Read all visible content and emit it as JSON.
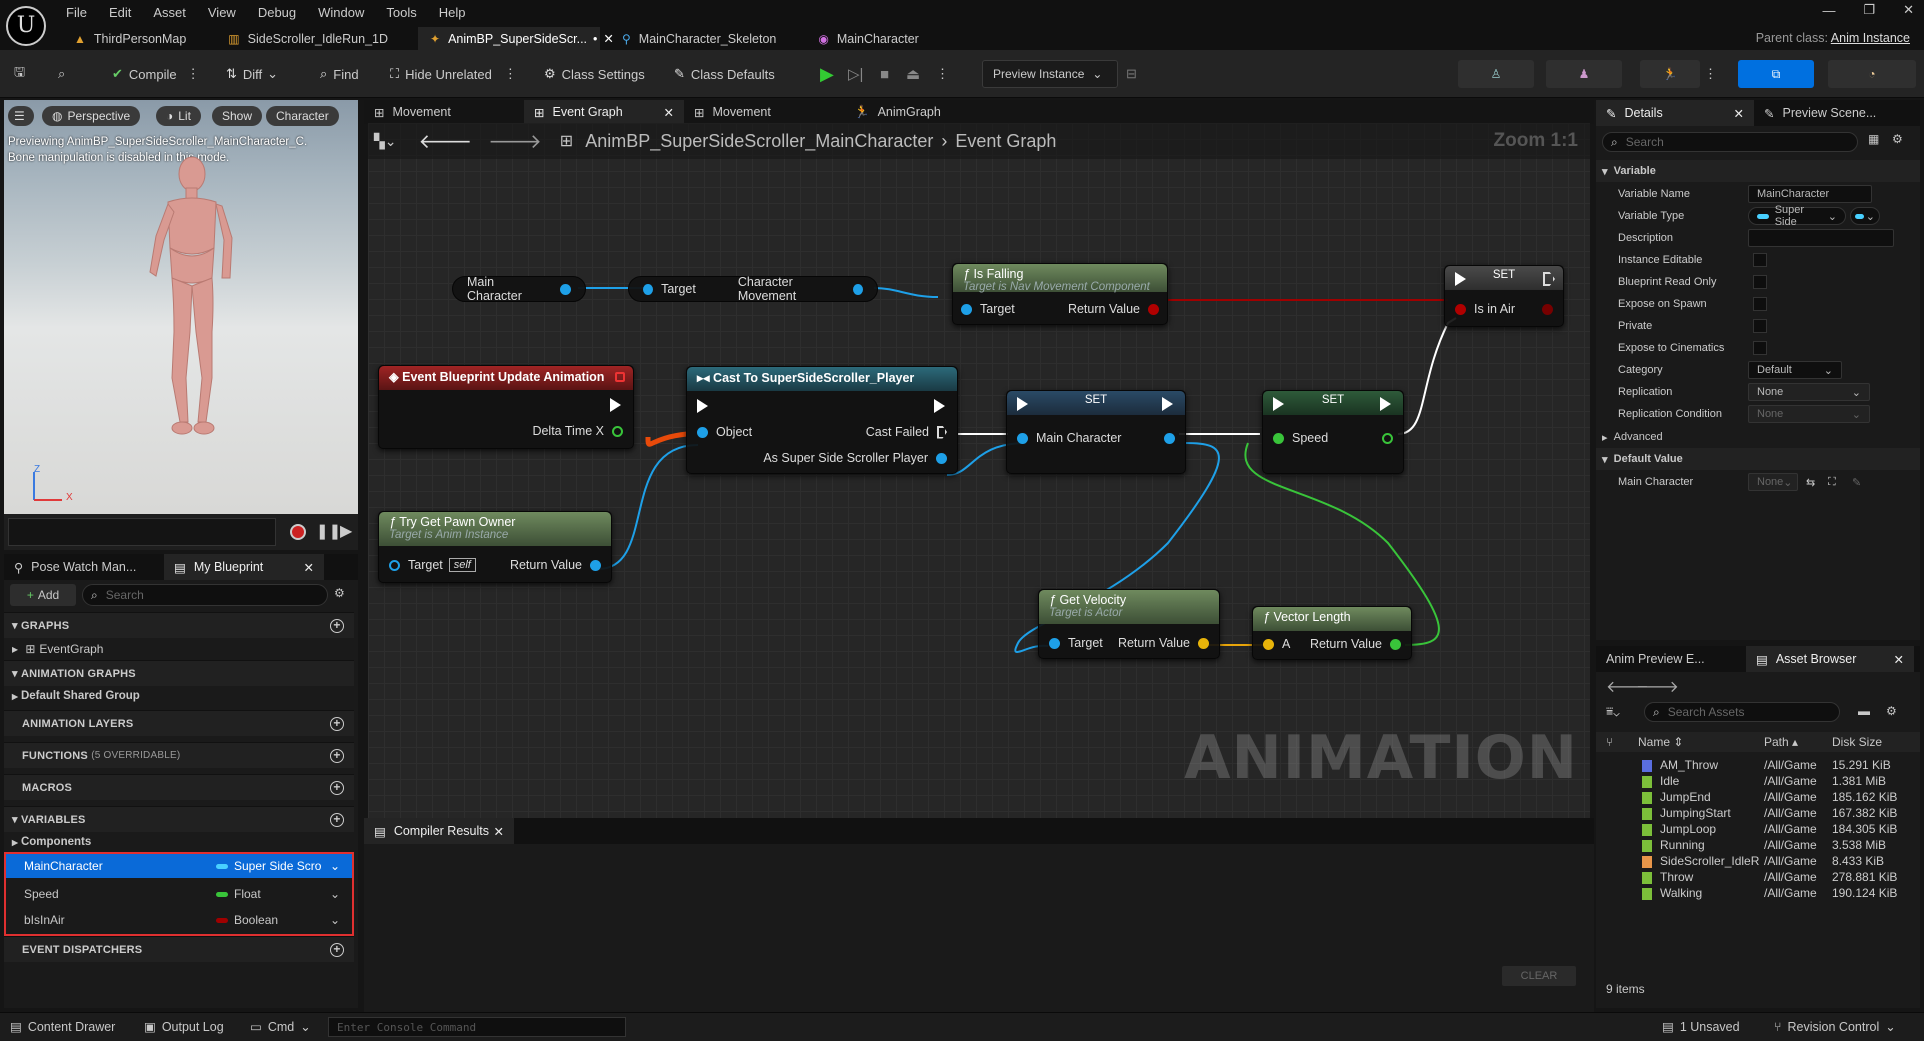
{
  "titlebar": {
    "menu": [
      "File",
      "Edit",
      "Asset",
      "View",
      "Debug",
      "Window",
      "Tools",
      "Help"
    ],
    "tabs": [
      {
        "label": "ThirdPersonMap",
        "icon": "level-icon"
      },
      {
        "label": "SideScroller_IdleRun_1D",
        "icon": "blendspace-icon"
      },
      {
        "label": "AnimBP_SuperSideScr...",
        "icon": "animbp-icon",
        "active": true,
        "badge": "•"
      },
      {
        "label": "MainCharacter_Skeleton",
        "icon": "skeleton-icon"
      },
      {
        "label": "MainCharacter",
        "icon": "mesh-icon"
      }
    ],
    "parent_label": "Parent class:",
    "parent_value": "Anim Instance"
  },
  "toolbar": {
    "compile": "Compile",
    "diff": "Diff",
    "find": "Find",
    "hide_unrelated": "Hide Unrelated",
    "class_settings": "Class Settings",
    "class_defaults": "Class Defaults",
    "preview_instance": "Preview Instance"
  },
  "viewport": {
    "perspective": "Perspective",
    "lit": "Lit",
    "show": "Show",
    "character": "Character",
    "msg1": "Previewing AnimBP_SuperSideScroller_MainCharacter_C.",
    "msg2": "Bone manipulation is disabled in this mode.",
    "axis_z": "Z",
    "axis_x": "X"
  },
  "left_panel": {
    "tab_pose": "Pose Watch Man...",
    "tab_bp": "My Blueprint",
    "add": "Add",
    "search_placeholder": "Search",
    "graphs": "GRAPHS",
    "event_graph": "EventGraph",
    "anim_graphs": "ANIMATION GRAPHS",
    "default_group": "Default Shared Group",
    "anim_layers": "ANIMATION LAYERS",
    "functions": "FUNCTIONS",
    "functions_note": "(5 OVERRIDABLE)",
    "macros": "MACROS",
    "variables": "VARIABLES",
    "components": "Components",
    "vars": [
      {
        "name": "MainCharacter",
        "type": "Super Side Scroll",
        "color": "#1ea0e8",
        "selected": true
      },
      {
        "name": "Speed",
        "type": "Float",
        "color": "#39c43a",
        "selected": false
      },
      {
        "name": "bIsInAir",
        "type": "Boolean",
        "color": "#a00000",
        "selected": false
      }
    ],
    "dispatchers": "EVENT DISPATCHERS"
  },
  "graph_tabs": {
    "t1": "Movement",
    "t2": "Event Graph",
    "t3": "Movement",
    "t4": "AnimGraph"
  },
  "graph": {
    "breadcrumb_bp": "AnimBP_SuperSideScroller_MainCharacter",
    "breadcrumb_graph": "Event Graph",
    "zoom": "Zoom 1:1",
    "watermark": "ANIMATION",
    "main_character_var": "Main Character",
    "char_move_target": "Target",
    "char_move_out": "Character Movement",
    "is_falling_title": "Is Falling",
    "is_falling_sub": "Target is Nav Movement Component",
    "is_falling_target": "Target",
    "is_falling_return": "Return Value",
    "set1_title": "SET",
    "set1_pin": "Is in Air",
    "event_title": "Event Blueprint Update Animation",
    "event_delta": "Delta Time X",
    "cast_title": "Cast To SuperSideScroller_Player",
    "cast_object": "Object",
    "cast_failed": "Cast Failed",
    "cast_as": "As Super Side Scroller Player",
    "set2_title": "SET",
    "set2_pin": "Main Character",
    "set3_title": "SET",
    "set3_pin": "Speed",
    "pawn_title": "Try Get Pawn Owner",
    "pawn_sub": "Target is Anim Instance",
    "pawn_target": "Target",
    "pawn_self": "self",
    "pawn_return": "Return Value",
    "vel_title": "Get Velocity",
    "vel_sub": "Target is Actor",
    "vel_target": "Target",
    "vel_return": "Return Value",
    "len_title": "Vector Length",
    "len_a": "A",
    "len_return": "Return Value"
  },
  "compiler": {
    "tab": "Compiler Results",
    "clear": "CLEAR"
  },
  "details": {
    "tab": "Details",
    "tab2": "Preview Scene...",
    "search_placeholder": "Search",
    "section_variable": "Variable",
    "rows": [
      {
        "label": "Variable Name",
        "value": "MainCharacter",
        "kind": "field"
      },
      {
        "label": "Variable Type",
        "value": "Super Side",
        "kind": "type"
      },
      {
        "label": "Description",
        "value": "",
        "kind": "field"
      },
      {
        "label": "Instance Editable",
        "kind": "check"
      },
      {
        "label": "Blueprint Read Only",
        "kind": "check"
      },
      {
        "label": "Expose on Spawn",
        "kind": "check"
      },
      {
        "label": "Private",
        "kind": "check"
      },
      {
        "label": "Expose to Cinematics",
        "kind": "check"
      },
      {
        "label": "Category",
        "value": "Default",
        "kind": "combo"
      },
      {
        "label": "Replication",
        "value": "None",
        "kind": "combo"
      },
      {
        "label": "Replication Condition",
        "value": "None",
        "kind": "combo"
      }
    ],
    "advanced": "Advanced",
    "section_default": "Default Value",
    "default_label": "Main Character",
    "default_value": "None"
  },
  "asset_browser": {
    "tab1": "Anim Preview E...",
    "tab2": "Asset Browser",
    "search_placeholder": "Search Assets",
    "col_name": "Name",
    "col_path": "Path",
    "col_size": "Disk Size",
    "items": [
      {
        "name": "AM_Throw",
        "path": "/All/Game",
        "size": "15.291 KiB",
        "color": "#5a6ee0"
      },
      {
        "name": "Idle",
        "path": "/All/Game",
        "size": "1.381 MiB",
        "color": "#7cbf3a"
      },
      {
        "name": "JumpEnd",
        "path": "/All/Game",
        "size": "185.162 KiB",
        "color": "#7cbf3a"
      },
      {
        "name": "JumpingStart",
        "path": "/All/Game",
        "size": "167.382 KiB",
        "color": "#7cbf3a"
      },
      {
        "name": "JumpLoop",
        "path": "/All/Game",
        "size": "184.305 KiB",
        "color": "#7cbf3a"
      },
      {
        "name": "Running",
        "path": "/All/Game",
        "size": "3.538 MiB",
        "color": "#7cbf3a"
      },
      {
        "name": "SideScroller_IdleR",
        "path": "/All/Game",
        "size": "8.433 KiB",
        "color": "#e8964a"
      },
      {
        "name": "Throw",
        "path": "/All/Game",
        "size": "278.881 KiB",
        "color": "#7cbf3a"
      },
      {
        "name": "Walking",
        "path": "/All/Game",
        "size": "190.124 KiB",
        "color": "#7cbf3a"
      }
    ],
    "count": "9 items"
  },
  "statusbar": {
    "content_drawer": "Content Drawer",
    "output_log": "Output Log",
    "cmd": "Cmd",
    "console_placeholder": "Enter Console Command",
    "unsaved": "1 Unsaved",
    "revision": "Revision Control"
  }
}
